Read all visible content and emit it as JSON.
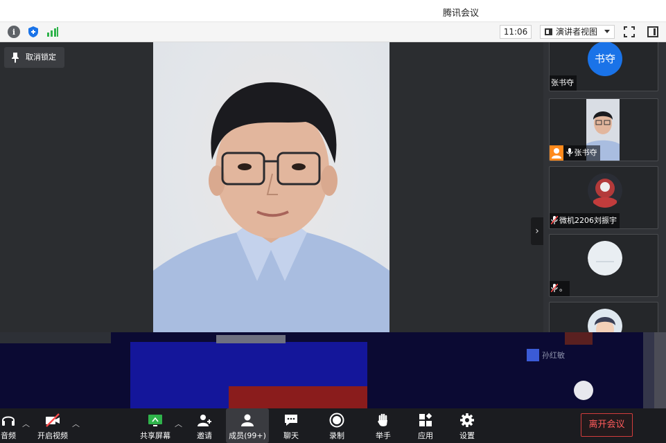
{
  "window": {
    "title": "腾讯会议"
  },
  "toolbar": {
    "info_icon": "info-icon",
    "shield_icon": "shield-icon",
    "signal_icon": "signal-icon",
    "time": "11:06",
    "view_label": "演讲者视图"
  },
  "main": {
    "unlock_label": "取消锁定"
  },
  "participants": [
    {
      "name": "张书夺",
      "avatar_text": "书夺",
      "avatar_color": "#1a73e8",
      "mic": "none"
    },
    {
      "name": "张书夺",
      "avatar_text": "",
      "avatar_color": "#c9d2e0",
      "mic": "on"
    },
    {
      "name": "微机2206刘振宇",
      "avatar_text": "",
      "avatar_color": "#b33a3a",
      "mic": "off"
    },
    {
      "name": "。",
      "avatar_text": "",
      "avatar_color": "#e9eef2",
      "mic": "off"
    }
  ],
  "overlay": {
    "name": "孙红敏"
  },
  "bottom_bar": {
    "audio": "音频",
    "video": "开启视频",
    "share": "共享屏幕",
    "invite": "邀请",
    "members": "成员(99+)",
    "chat": "聊天",
    "record": "录制",
    "raise_hand": "举手",
    "apps": "应用",
    "settings": "设置",
    "leave": "离开会议"
  },
  "colors": {
    "accent": "#1a73e8",
    "leave": "#ff5b5b",
    "glitch_bg": "#0b0a33"
  }
}
